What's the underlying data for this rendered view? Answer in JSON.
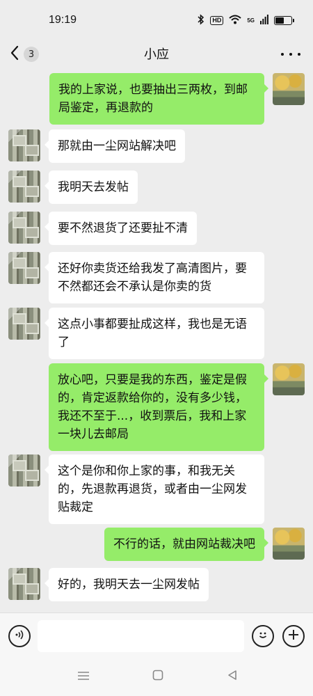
{
  "status_bar": {
    "time": "19:19",
    "hd_label": "HD",
    "network_label": "5G",
    "battery_level": 0.55
  },
  "header": {
    "back_icon": "chevron-left-icon",
    "unread_count": "3",
    "title": "小应",
    "more_icon": "more-dots-icon"
  },
  "messages": [
    {
      "side": "right",
      "text": "我的上家说，也要抽出三两枚，到邮局鉴定，再退款的"
    },
    {
      "side": "left",
      "text": "那就由一尘网站解决吧"
    },
    {
      "side": "left",
      "text": "我明天去发帖"
    },
    {
      "side": "left",
      "text": "要不然退货了还要扯不清"
    },
    {
      "side": "left",
      "text": "还好你卖货还给我发了高清图片，要不然都还会不承认是你卖的货"
    },
    {
      "side": "left",
      "text": "这点小事都要扯成这样，我也是无语了"
    },
    {
      "side": "right",
      "text": "放心吧，只要是我的东西，鉴定是假的，肯定返款给你的，没有多少钱，我还不至于...，收到票后，我和上家一块儿去邮局"
    },
    {
      "side": "left",
      "text": "这个是你和你上家的事，和我无关的，先退款再退货，或者由一尘网发贴裁定"
    },
    {
      "side": "right",
      "text": "不行的话，就由网站裁决吧"
    },
    {
      "side": "left",
      "text": "好的，我明天去一尘网发帖"
    }
  ],
  "input_bar": {
    "voice_icon": "voice-icon",
    "text_value": "",
    "emoji_icon": "emoji-icon",
    "plus_icon": "plus-icon"
  },
  "colors": {
    "background": "#ededed",
    "outgoing_bubble": "#95ec69",
    "incoming_bubble": "#ffffff"
  }
}
